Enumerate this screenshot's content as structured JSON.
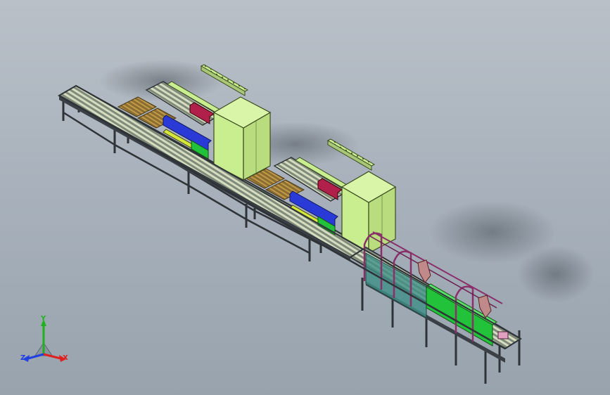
{
  "viewport": {
    "background_top": "#b9c0c8",
    "background_bottom": "#98a3ae"
  },
  "model": {
    "frame_color": "#2e3338",
    "roller_color": "#c9d3a8",
    "cabinet_color": "#c9ee8f",
    "rail_color": "#c9ee8f",
    "tray_color": "#9a7d3a",
    "blue_part": "#2a3ad6",
    "red_part": "#b0204a",
    "green_guard": "#22c23a",
    "teal_guard": "#3f8f86",
    "arch_color": "#8a2f6a"
  },
  "triad": {
    "icon": "axis-triad-icon",
    "x_label": "X",
    "y_label": "Y",
    "z_label": "Z",
    "x_color": "#e02020",
    "y_color": "#20b020",
    "z_color": "#2040e0"
  }
}
